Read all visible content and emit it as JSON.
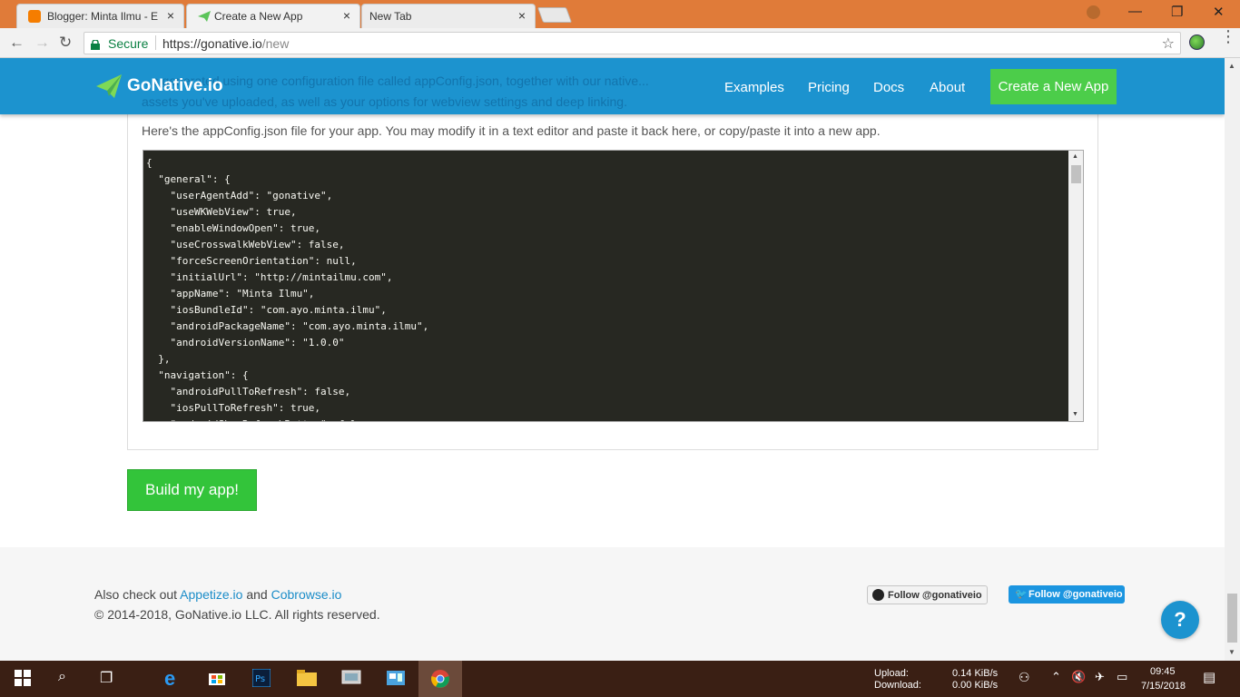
{
  "browser": {
    "tabs": [
      {
        "title": "Blogger: Minta Ilmu - Edi",
        "close": "×"
      },
      {
        "title": "Create a New App",
        "close": "×"
      },
      {
        "title": "New Tab",
        "close": "×"
      }
    ],
    "window_controls": {
      "minimize": "—",
      "maximize": "❐",
      "close": "✕"
    },
    "toolbar": {
      "back": "←",
      "forward": "→",
      "reload": "↻",
      "star": "☆",
      "menu": "⋮"
    },
    "secure_label": "Secure",
    "url_host": "https://gonative.io",
    "url_path": "/new"
  },
  "site": {
    "brand": "GoNative.io",
    "nav": [
      {
        "label": "Examples"
      },
      {
        "label": "Pricing"
      },
      {
        "label": "Docs"
      },
      {
        "label": "About"
      }
    ],
    "cta": "Create a New App",
    "ghost_line1": "...s generated using one configuration file called appConfig.json, together with our native...",
    "ghost_line2": "assets you've uploaded, as well as your options for webview settings and deep linking.",
    "panel_desc": "Here's the appConfig.json file for your app. You may modify it in a text editor and paste it back here, or copy/paste it into a new app.",
    "code_lines": [
      "{",
      "  \"general\": {",
      "    \"userAgentAdd\": \"gonative\",",
      "    \"useWKWebView\": true,",
      "    \"enableWindowOpen\": true,",
      "    \"useCrosswalkWebView\": false,",
      "    \"forceScreenOrientation\": null,",
      "    \"initialUrl\": \"http://mintailmu.com\",",
      "    \"appName\": \"Minta Ilmu\",",
      "    \"iosBundleId\": \"com.ayo.minta.ilmu\",",
      "    \"androidPackageName\": \"com.ayo.minta.ilmu\",",
      "    \"androidVersionName\": \"1.0.0\"",
      "  },",
      "  \"navigation\": {",
      "    \"androidPullToRefresh\": false,",
      "    \"iosPullToRefresh\": true,",
      "    \"androidShowRefreshButton\": false,"
    ],
    "build_button": "Build my app!",
    "footer": {
      "also_prefix": "Also check out ",
      "link1": "Appetize.io",
      "and": " and ",
      "link2": "Cobrowse.io",
      "copyright": "© 2014-2018, GoNative.io LLC. All rights reserved.",
      "github_follow": "Follow @gonativeio",
      "twitter_follow": "Follow @gonativeio"
    },
    "help": "?"
  },
  "taskbar": {
    "upload_label": "Upload:",
    "download_label": "Download:",
    "upload_value": "0.14 KiB/s",
    "download_value": "0.00 KiB/s",
    "time": "09:45",
    "date": "7/15/2018"
  },
  "colors": {
    "header": "#1c93cf",
    "cta": "#4ccd4a",
    "build": "#33c43a",
    "code_bg": "#272822",
    "tabstrip": "#e07b39",
    "taskbar": "#3a1f14"
  }
}
